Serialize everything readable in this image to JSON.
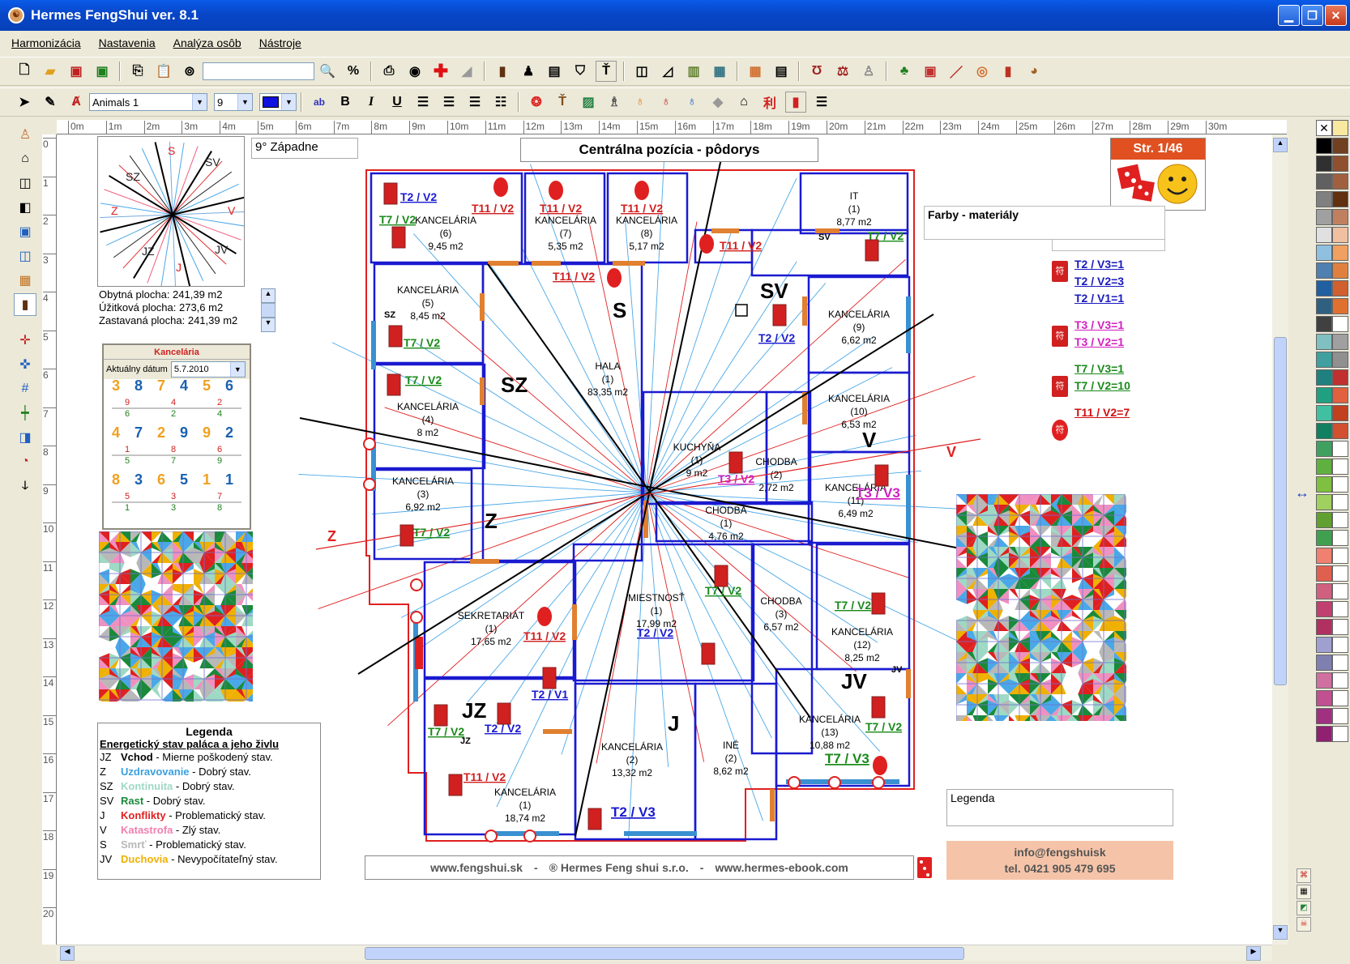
{
  "app": {
    "title": "Hermes FengShui ver. 8.1"
  },
  "menu": [
    "Harmonizácia",
    "Nastavenia",
    "Analýza osôb",
    "Nástroje"
  ],
  "toolbar2": {
    "font": "Animals 1",
    "size": "9",
    "color": "#1010E0"
  },
  "ruler": {
    "top": [
      "0m",
      "1m",
      "2m",
      "3m",
      "4m",
      "5m",
      "6m",
      "7m",
      "8m",
      "9m",
      "10m",
      "11m",
      "12m",
      "13m",
      "14m",
      "15m",
      "16m",
      "17m",
      "18m",
      "19m",
      "20m",
      "21m",
      "22m",
      "23m",
      "24m",
      "25m",
      "26m",
      "27m",
      "28m",
      "29m",
      "30m"
    ],
    "left": [
      "0",
      "1",
      "2",
      "3",
      "4",
      "5",
      "6",
      "7",
      "8",
      "9",
      "10",
      "11",
      "12",
      "13",
      "14",
      "15",
      "16",
      "17",
      "18",
      "19",
      "20"
    ]
  },
  "header": {
    "direction_box": "9° Západne",
    "title": "Centrálna pozícia - pôdorys",
    "page": "Str. 1/46"
  },
  "compass_labels": [
    "S",
    "SV",
    "V",
    "JV",
    "J",
    "JZ",
    "Z",
    "SZ"
  ],
  "areas": {
    "obytna": "Obytná plocha: 241,39 m2",
    "uzitkova": "Úžitková plocha: 273,6 m2",
    "zastavana": "Zastavaná plocha: 241,39 m2"
  },
  "grid_panel": {
    "title": "Kancelária",
    "date_label": "Aktuálny dátum",
    "date_value": "5.7.2010",
    "cells": [
      {
        "nums": [
          "3",
          "8",
          "7",
          "4",
          "5",
          "6"
        ]
      },
      {
        "small": [
          "9",
          "4",
          "2"
        ]
      },
      {
        "small2": [
          "6",
          "2",
          "4"
        ]
      },
      {
        "nums2": [
          "4",
          "7",
          "2",
          "9",
          "9",
          "2"
        ]
      },
      {
        "small3": [
          "1",
          "8",
          "6"
        ]
      },
      {
        "small4": [
          "5",
          "7",
          "9"
        ]
      },
      {
        "nums3": [
          "8",
          "3",
          "6",
          "5",
          "1",
          "1"
        ]
      },
      {
        "small5": [
          "5",
          "3",
          "7"
        ]
      },
      {
        "small6": [
          "1",
          "3",
          "8"
        ]
      }
    ]
  },
  "farby_box": "Farby - materiály",
  "legend_panel": {
    "title": "Legenda",
    "subtitle": "Energetický stav paláca a jeho živlu",
    "rows": [
      {
        "dir": "JZ",
        "name": "Vchod",
        "desc": " - Mierne poškodený stav.",
        "color": "#000000"
      },
      {
        "dir": "Z",
        "name": "Uzdravovanie",
        "desc": " - Dobrý stav.",
        "color": "#3AA0E0"
      },
      {
        "dir": "SZ",
        "name": "Kontinuita",
        "desc": " - Dobrý stav.",
        "color": "#9ED9C4"
      },
      {
        "dir": "SV",
        "name": "Rast",
        "desc": " - Dobrý stav.",
        "color": "#1A8A3A"
      },
      {
        "dir": "J",
        "name": "Konflikty",
        "desc": " - Problematický stav.",
        "color": "#E02020"
      },
      {
        "dir": "V",
        "name": "Katastrofa",
        "desc": " - Zlý stav.",
        "color": "#F080B0"
      },
      {
        "dir": "S",
        "name": "Smrť",
        "desc": " - Problematický stav.",
        "color": "#B8B8B8"
      },
      {
        "dir": "JV",
        "name": "Duchovia",
        "desc": " - Nevypočítateľný stav.",
        "color": "#F0B000"
      }
    ]
  },
  "legend_box": "Legenda",
  "right_stats": [
    {
      "label": "T2 / V3=1",
      "color": "#1A1AC0"
    },
    {
      "label": "T2 / V2=3",
      "color": "#1A1AC0"
    },
    {
      "label": "T2 / V1=1",
      "color": "#1A1AC0"
    },
    {
      "label": "T3 / V3=1",
      "color": "#D020C0"
    },
    {
      "label": "T3 / V2=1",
      "color": "#D020C0"
    },
    {
      "label": "T7 / V3=1",
      "color": "#1A8A1A"
    },
    {
      "label": "T7 / V2=10",
      "color": "#1A8A1A"
    },
    {
      "label": "T11 / V2=7",
      "color": "#D01010"
    }
  ],
  "footer": {
    "web1": "www.fengshui.sk",
    "dash1": "-",
    "company": "® Hermes Feng shui s.r.o.",
    "dash2": "-",
    "web2": "www.hermes-ebook.com",
    "email": "info@fengshuisk",
    "phone": "tel. 0421 905 479 695"
  },
  "rooms": [
    {
      "name": "KANCELÁRIA",
      "num": "(6)",
      "area": "9,45 m2"
    },
    {
      "name": "KANCELÁRIA",
      "num": "(7)",
      "area": "5,35 m2"
    },
    {
      "name": "KANCELÁRIA",
      "num": "(8)",
      "area": "5,17 m2"
    },
    {
      "name": "IT",
      "num": "(1)",
      "area": "8,77 m2"
    },
    {
      "name": "KANCELÁRIA",
      "num": "(5)",
      "area": "8,45 m2"
    },
    {
      "name": "HALA",
      "num": "(1)",
      "area": "83,35 m2"
    },
    {
      "name": "KANCELÁRIA",
      "num": "(9)",
      "area": "6,62 m2"
    },
    {
      "name": "KANCELÁRIA",
      "num": "(4)",
      "area": "8 m2"
    },
    {
      "name": "KANCELÁRIA",
      "num": "(10)",
      "area": "6,53 m2"
    },
    {
      "name": "KUCHYŇA",
      "num": "(1)",
      "area": "9 m2"
    },
    {
      "name": "CHODBA",
      "num": "(2)",
      "area": "2,72 m2"
    },
    {
      "name": "KANCELÁRIA",
      "num": "(3)",
      "area": "6,92 m2"
    },
    {
      "name": "CHODBA",
      "num": "(1)",
      "area": "4,76 m2"
    },
    {
      "name": "KANCELÁRIA",
      "num": "(11)",
      "area": "6,49 m2"
    },
    {
      "name": "SEKRETARIÁT",
      "num": "(1)",
      "area": "17,65 m2"
    },
    {
      "name": "MIESTNOSŤ",
      "num": "(1)",
      "area": "17,99 m2"
    },
    {
      "name": "CHODBA",
      "num": "(3)",
      "area": "6,57 m2"
    },
    {
      "name": "KANCELÁRIA",
      "num": "(12)",
      "area": "8,25 m2"
    },
    {
      "name": "KANCELÁRIA",
      "num": "(2)",
      "area": "13,32 m2"
    },
    {
      "name": "INÉ",
      "num": "(2)",
      "area": "8,62 m2"
    },
    {
      "name": "KANCELÁRIA",
      "num": "(13)",
      "area": "10,88 m2"
    },
    {
      "name": "KANCELÁRIA",
      "num": "(1)",
      "area": "18,74 m2"
    }
  ],
  "zones": [
    "SZ",
    "S",
    "SV",
    "V",
    "Z",
    "JZ",
    "J",
    "JV"
  ],
  "tags": [
    "T2 / V2",
    "T11 / V2",
    "T11 / V2",
    "T11 / V2",
    "T7 / V2",
    "T11 / V2",
    "T7 / V2",
    "T11 / V2",
    "T2 / V2",
    "T7 / V2",
    "T7 / V2",
    "T3 / V2",
    "T3 / V3",
    "T7 / V2",
    "T7 / V2",
    "T7 / V2",
    "T11 / V2",
    "T2 / V2",
    "T2 / V1",
    "T7 / V2",
    "T2 / V2",
    "T7 / V2",
    "T7 / V3",
    "T11 / V2",
    "T2 / V3"
  ]
}
